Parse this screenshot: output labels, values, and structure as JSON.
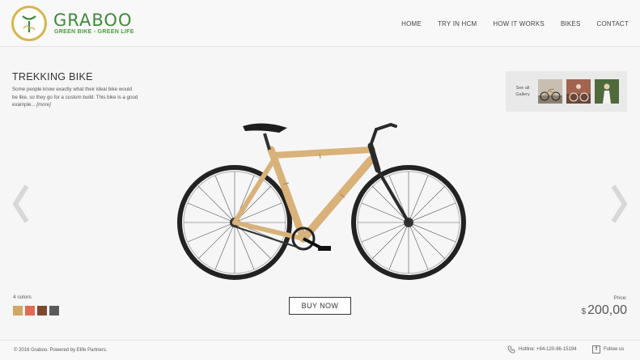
{
  "brand": {
    "name": "GRABOO",
    "tagline": "GREEN BIKE - GREEN LIFE"
  },
  "nav": [
    "HOME",
    "TRY IN HCM",
    "HOW IT WORKS",
    "BIKES",
    "CONTACT"
  ],
  "product": {
    "title": "TREKKING BIKE",
    "description": "Some people know exactly what their ideal bike would be like, so they go for a custom build. This bike is a good example...",
    "more_label": "[more]",
    "colors_label": "4 colors",
    "colors": [
      "#d2a866",
      "#e46a55",
      "#7b4a2e",
      "#5a5a5a"
    ],
    "buy_label": "BUY NOW",
    "price_label": "Price:",
    "price_currency": "$",
    "price_value": "200,00"
  },
  "gallery": {
    "see_all_label": "See all Gallery",
    "thumb_count": 3
  },
  "icons": [
    "logo-icon",
    "prev-arrow-icon",
    "next-arrow-icon",
    "phone-icon",
    "facebook-icon"
  ],
  "footer": {
    "copyright": "© 2016 Graboo. Powered by Elife Partners.",
    "hotline": "Hotline: +84-120-86-15194",
    "follow": "Follow us"
  },
  "colors": {
    "brand_green": "#3f8a3a",
    "logo_gold": "#d8b44a",
    "bamboo": "#d9b27a"
  }
}
